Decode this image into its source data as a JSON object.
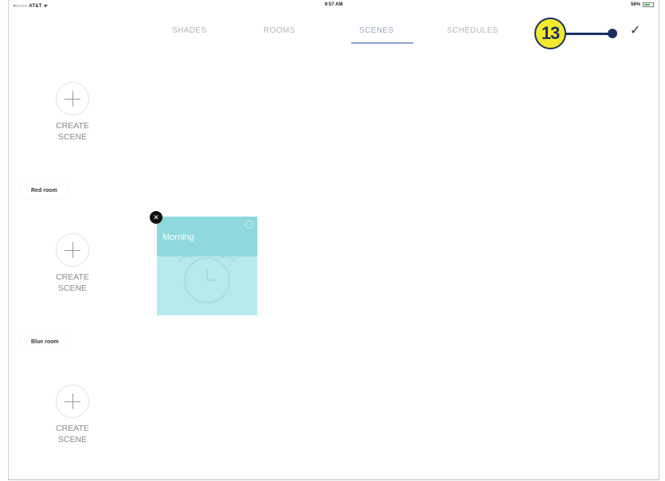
{
  "status_bar": {
    "carrier": "•○○○○ AT&T ᯤ",
    "time": "9:57 AM",
    "battery_pct": "56%"
  },
  "tabs": [
    {
      "label": "SHADES",
      "active": false
    },
    {
      "label": "ROOMS",
      "active": false
    },
    {
      "label": "SCENES",
      "active": true
    },
    {
      "label": "SCHEDULES",
      "active": false
    }
  ],
  "done_icon": "checkmark-icon",
  "callout": {
    "number": "13"
  },
  "sections": {
    "top": {
      "create_label_1": "CREATE",
      "create_label_2": "SCENE"
    },
    "red_room": {
      "title": "Red room",
      "create_label_1": "CREATE",
      "create_label_2": "SCENE"
    },
    "blue_room": {
      "title": "Blue room",
      "create_label_1": "CREATE",
      "create_label_2": "SCENE"
    }
  },
  "scene_card": {
    "name": "Morning",
    "icon": "alarm-clock-icon",
    "delete_icon": "close-icon",
    "colors": {
      "top": "#8ed8de",
      "bottom": "#b7e9ed"
    }
  }
}
